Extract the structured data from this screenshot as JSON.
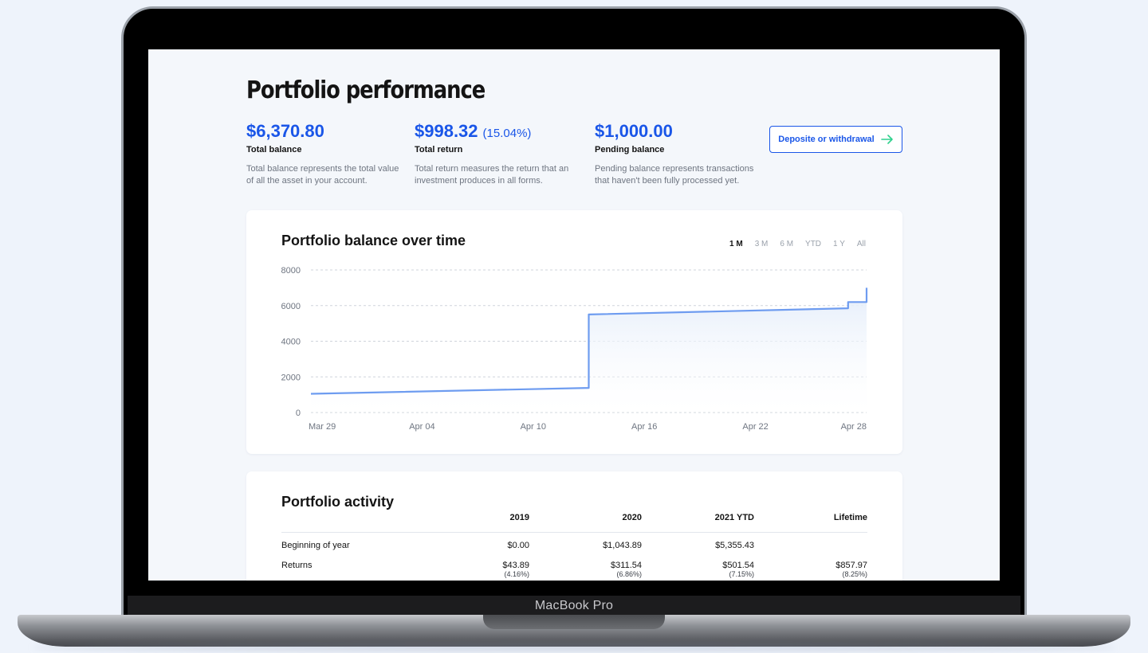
{
  "device": {
    "label": "MacBook Pro"
  },
  "page": {
    "title": "Portfolio performance"
  },
  "stats": [
    {
      "value": "$6,370.80",
      "pct": "",
      "label": "Total balance",
      "desc": "Total balance represents the total value of all the asset in your account."
    },
    {
      "value": "$998.32",
      "pct": "(15.04%)",
      "label": "Total return",
      "desc": "Total return measures the return that an investment produces in all forms."
    },
    {
      "value": "$1,000.00",
      "pct": "",
      "label": "Pending balance",
      "desc": "Pending balance represents transactions that haven't been fully processed yet."
    }
  ],
  "deposit_button": {
    "label": "Deposite or withdrawal",
    "icon": "arrow-right-icon"
  },
  "colors": {
    "accent": "#1a56e8",
    "line": "#6e9cf0",
    "arrow": "#2fd18d"
  },
  "chart": {
    "title": "Portfolio balance over time",
    "ranges": [
      "1 M",
      "3 M",
      "6 M",
      "YTD",
      "1 Y",
      "All"
    ],
    "active_range": "1 M"
  },
  "chart_data": {
    "type": "area",
    "x_ticks": [
      "Mar 29",
      "Apr 04",
      "Apr 10",
      "Apr 16",
      "Apr 22",
      "Apr 28"
    ],
    "y_ticks": [
      "8000",
      "6000",
      "4000",
      "2000",
      "0"
    ],
    "ylim": [
      0,
      8000
    ],
    "grid": true,
    "series": [
      {
        "points": [
          {
            "x": "Mar 29",
            "y": 1050
          },
          {
            "x": "Apr 13",
            "y": 1380
          },
          {
            "x": "Apr 13",
            "y": 5500
          },
          {
            "x": "Apr 27",
            "y": 5850
          },
          {
            "x": "Apr 27",
            "y": 6200
          },
          {
            "x": "Apr 28",
            "y": 6200
          },
          {
            "x": "Apr 28",
            "y": 7000
          }
        ]
      }
    ]
  },
  "activity": {
    "title": "Portfolio activity",
    "columns": [
      "",
      "2019",
      "2020",
      "2021 YTD",
      "Lifetime"
    ],
    "rows": [
      {
        "label": "Beginning of year",
        "cells": [
          {
            "v": "$0.00",
            "s": ""
          },
          {
            "v": "$1,043.89",
            "s": ""
          },
          {
            "v": "$5,355.43",
            "s": ""
          },
          {
            "v": "",
            "s": ""
          }
        ]
      },
      {
        "label": "Returns",
        "cells": [
          {
            "v": "$43.89",
            "s": "(4.16%)"
          },
          {
            "v": "$311.54",
            "s": "(6.86%)"
          },
          {
            "v": "$501.54",
            "s": "(7.15%)"
          },
          {
            "v": "$857.97",
            "s": "(8.25%)"
          }
        ]
      }
    ]
  }
}
